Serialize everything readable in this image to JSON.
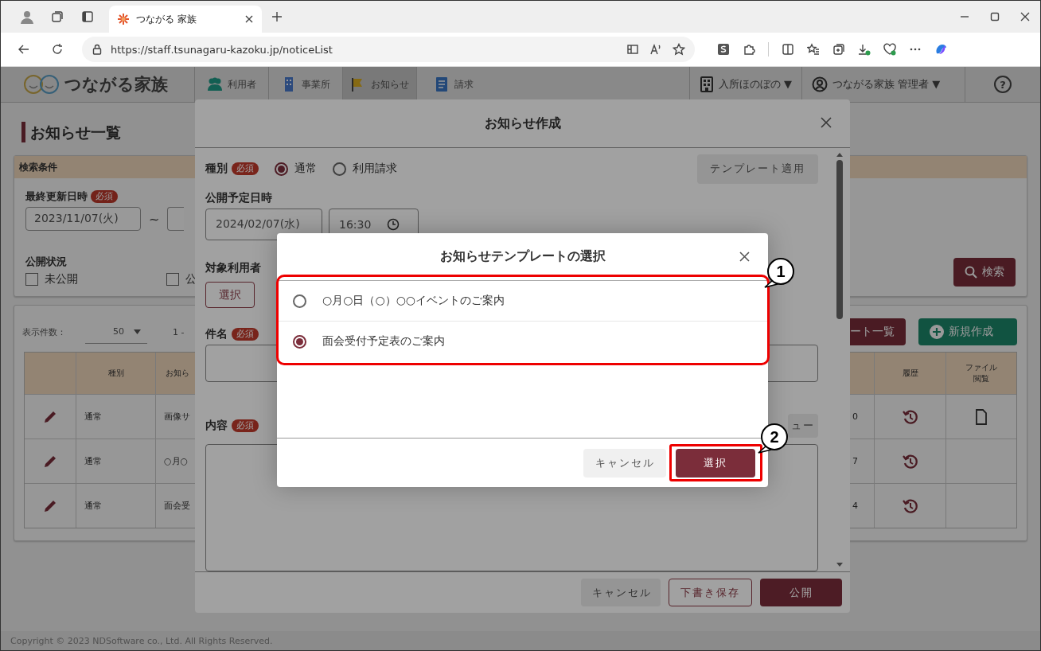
{
  "browser": {
    "tab_title": "つながる 家族",
    "url": "https://staff.tsunagaru-kazoku.jp/noticeList"
  },
  "app_header": {
    "logo": "つながる家族",
    "nav": [
      {
        "label": "利用者",
        "selected": false
      },
      {
        "label": "事業所",
        "selected": false
      },
      {
        "label": "お知らせ",
        "selected": true
      },
      {
        "label": "請求",
        "selected": false
      }
    ],
    "facility": "入所ほのぼの ▼",
    "user": "つながる家族 管理者 ▼",
    "help": "?"
  },
  "page": {
    "title": "お知らせ一覧",
    "search": {
      "header": "検索条件",
      "date_label": "最終更新日時",
      "date_badge": "必須",
      "date_from": "2023/11/07(火)",
      "range_sep": "~",
      "status_label": "公開状況",
      "status_options": [
        {
          "label": "未公開",
          "checked": false
        },
        {
          "label": "公",
          "checked": false
        }
      ],
      "search_button": "検索"
    },
    "list": {
      "page_size_label": "表示件数：",
      "page_size": "50",
      "range": "1 -",
      "template_list_button": "ート一覧",
      "new_button": "新規作成",
      "columns": {
        "type": "種別",
        "title": "お知ら",
        "history": "履歴",
        "file": "ファイル閲覧"
      },
      "rows": [
        {
          "type": "通常",
          "title": "画像サ",
          "column_4": "0",
          "has_file": true
        },
        {
          "type": "通常",
          "title": "○月○",
          "column_4": "7",
          "has_file": false
        },
        {
          "type": "通常",
          "title": "面会受",
          "column_4": "4",
          "has_file": false
        }
      ]
    },
    "footer": "Copyright © 2023 NDSoftware co., Ltd. All Rights Reserved."
  },
  "notice_modal": {
    "title": "お知らせ作成",
    "type_label": "種別",
    "type_badge": "必須",
    "types": [
      {
        "label": "通常",
        "selected": true
      },
      {
        "label": "利用請求",
        "selected": false
      }
    ],
    "template_button": "テンプレート適用",
    "schedule_label": "公開予定日時",
    "date": "2024/02/07(水)",
    "time": "16:30",
    "target_label": "対象利用者",
    "target_button": "選択",
    "subject_label": "件名",
    "subject_badge": "必須",
    "content_label": "内容",
    "content_badge": "必須",
    "preview_button": "ュー",
    "cancel_button": "キャンセル",
    "draft_button": "下書き保存",
    "publish_button": "公開"
  },
  "template_modal": {
    "title": "お知らせテンプレートの選択",
    "templates": [
      {
        "label": "○月○日（○）○○イベントのご案内",
        "selected": false
      },
      {
        "label": "面会受付予定表のご案内",
        "selected": true
      }
    ],
    "cancel_button": "キャンセル",
    "select_button": "選択"
  },
  "annotations": [
    {
      "number": "1"
    },
    {
      "number": "2"
    }
  ]
}
